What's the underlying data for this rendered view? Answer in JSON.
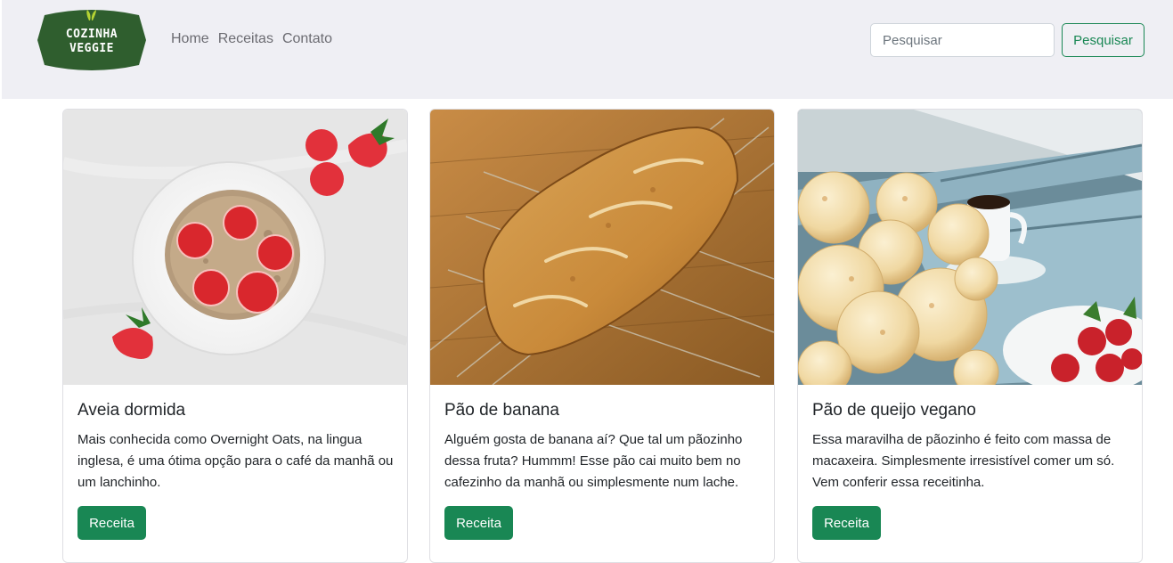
{
  "brand": {
    "logo_line1": "COZINHA",
    "logo_line2": "VEGGIE"
  },
  "nav": {
    "items": [
      "Home",
      "Receitas",
      "Contato"
    ]
  },
  "search": {
    "placeholder": "Pesquisar",
    "value": "",
    "button_label": "Pesquisar"
  },
  "colors": {
    "navbar_bg": "#efeff4",
    "brand_green": "#2f5e2e",
    "accent_green": "#198754",
    "leaf": "#b5d334"
  },
  "cards": [
    {
      "title": "Aveia dormida",
      "text": "Mais conhecida como Overnight Oats, na lingua inglesa, é uma ótima opção para o café da manhã ou um lanchinho.",
      "button_label": "Receita",
      "image": "overnight-oats-with-strawberries"
    },
    {
      "title": "Pão de banana",
      "text": "Alguém gosta de banana aí? Que tal um pãozinho dessa fruta? Hummm! Esse pão cai muito bem no cafezinho da manhã ou simplesmente num lache.",
      "button_label": "Receita",
      "image": "banana-bread-on-cooling-rack"
    },
    {
      "title": "Pão de queijo vegano",
      "text": "Essa maravilha de pãozinho é feito com massa de macaxeira. Simplesmente irresistível comer um só. Vem conferir essa receitinha.",
      "button_label": "Receita",
      "image": "cheese-bread-with-coffee"
    }
  ]
}
